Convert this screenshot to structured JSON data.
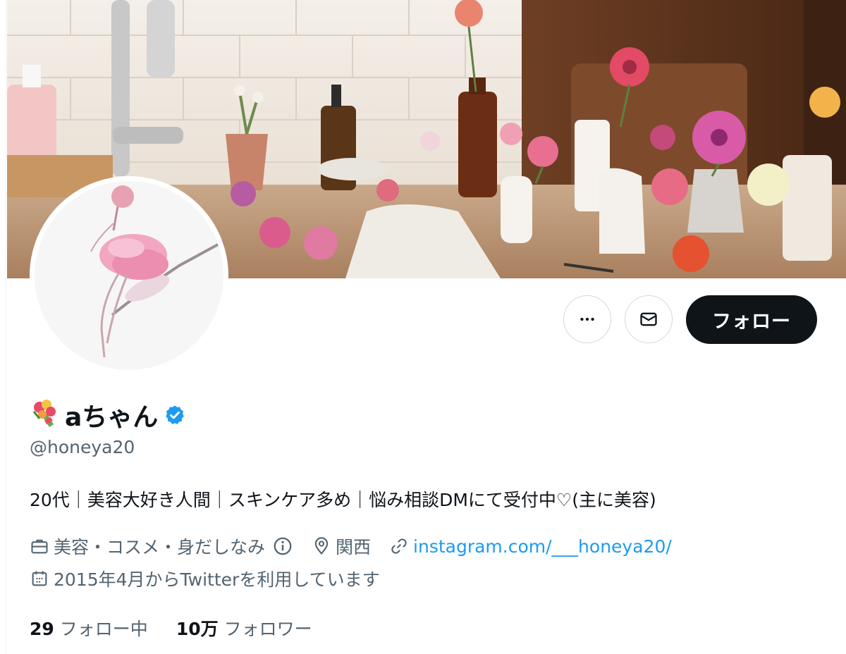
{
  "profile": {
    "display_name": "aちゃん",
    "handle": "@honeya20",
    "bio": "20代｜美容大好き人間｜スキンケア多め｜悩み相談DMにて受付中♡(主に美容)",
    "category": "美容・コスメ・身だしなみ",
    "location": "関西",
    "link": "instagram.com/___honeya20/",
    "joined": "2015年4月からTwitterを利用しています",
    "verified": true
  },
  "actions": {
    "more_icon": "more-icon",
    "message_icon": "mail-icon",
    "follow_label": "フォロー"
  },
  "stats": {
    "following_count": "29",
    "following_label": "フォロー中",
    "followers_count": "10万",
    "followers_label": "フォロワー"
  },
  "colors": {
    "accent": "#1d9bf0",
    "text_primary": "#0f1419",
    "text_secondary": "#536471",
    "follow_button": "#0f1419",
    "border": "#cfd9de"
  }
}
